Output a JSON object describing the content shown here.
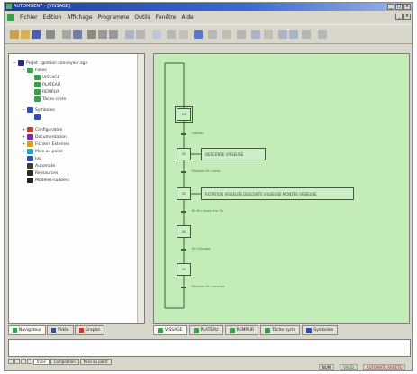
{
  "window": {
    "title": "AUTOMGEN7 - [VISSAGE]",
    "min": "_",
    "max": "□",
    "close": "×"
  },
  "menu": [
    "Fichier",
    "Edition",
    "Affichage",
    "Programme",
    "Outils",
    "Fenêtre",
    "Aide"
  ],
  "toolbar_icons": [
    "new-icon",
    "open-icon",
    "save-icon",
    "print-icon",
    "cut-icon",
    "copy-icon",
    "paste-icon",
    "grid-icon",
    "grid-icon",
    "run-icon",
    "stop-icon",
    "compile-icon",
    "step-icon",
    "transition-icon",
    "link-icon",
    "zoom-in-icon",
    "zoom-out-icon",
    "help-icon",
    "zoom-icon",
    "zoom-icon",
    "close-icon",
    "window-icon",
    "gear-icon"
  ],
  "tree": {
    "project": "Projet : gestion convoyeur.agn",
    "folios_label": "Folios",
    "folios": [
      "VISSAGE",
      "PLATEAU",
      "REMPLIR",
      "Tâche cycle"
    ],
    "symbols_label": "Symboles",
    "items": [
      "Configuration",
      "Documentation",
      "Fichiers Externes",
      "Mise au point",
      "Ivo",
      "Automate",
      "Ressources",
      "Modèles-sudoers"
    ]
  },
  "panel_tabs": [
    "Navigateur",
    "Vidéo",
    "Graphe"
  ],
  "grafcet": {
    "steps": [
      "10",
      "20",
      "30",
      "40",
      "50"
    ],
    "actions": [
      "DESCENTE VISSEUSE",
      "ROTATION VISSEUSE DESCENTE VISSEUSE MONTEE VISSEUSE"
    ],
    "transitions": [
      "Départ",
      "Position fin visse",
      "fin fin visse tmr 5s",
      "fin Vissage",
      "Position fin vissage"
    ]
  },
  "doc_tabs": [
    "VISSAGE",
    "PLATEAU",
    "REMPLIR",
    "Tâche cycle",
    "Symboles"
  ],
  "output_tabs": [
    "Infos",
    "Compilation",
    "Mise au point"
  ],
  "status": [
    "NUM",
    "VALID",
    "AUTOMATE ARRÊTÉ"
  ]
}
